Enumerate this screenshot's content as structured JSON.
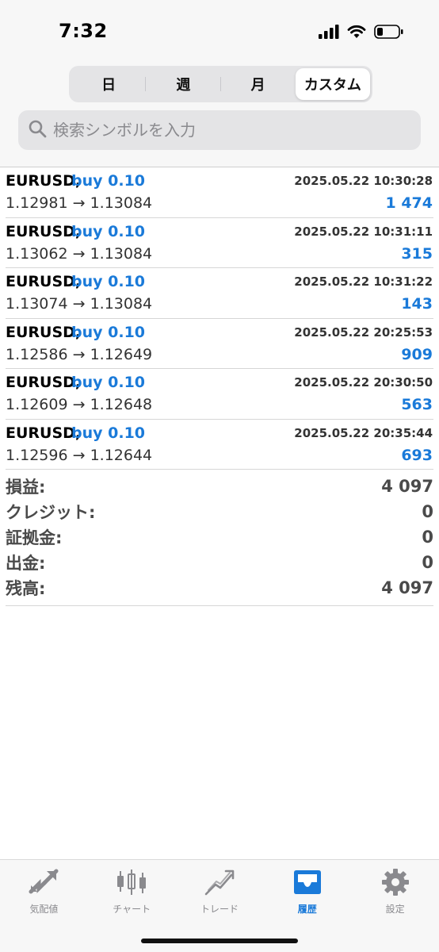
{
  "status": {
    "time": "7:32"
  },
  "segments": [
    {
      "label": "日"
    },
    {
      "label": "週"
    },
    {
      "label": "月"
    },
    {
      "label": "カスタム",
      "active": true
    }
  ],
  "search": {
    "placeholder": "検索シンボルを入力",
    "value": ""
  },
  "deals": [
    {
      "symbol": "EURUSD,",
      "type": "buy 0.10",
      "time": "2025.05.22 10:30:28",
      "prices": "1.12981 → 1.13084",
      "profit": "1 474"
    },
    {
      "symbol": "EURUSD,",
      "type": "buy 0.10",
      "time": "2025.05.22 10:31:11",
      "prices": "1.13062 → 1.13084",
      "profit": "315"
    },
    {
      "symbol": "EURUSD,",
      "type": "buy 0.10",
      "time": "2025.05.22 10:31:22",
      "prices": "1.13074 → 1.13084",
      "profit": "143"
    },
    {
      "symbol": "EURUSD,",
      "type": "buy 0.10",
      "time": "2025.05.22 20:25:53",
      "prices": "1.12586 → 1.12649",
      "profit": "909"
    },
    {
      "symbol": "EURUSD,",
      "type": "buy 0.10",
      "time": "2025.05.22 20:30:50",
      "prices": "1.12609 → 1.12648",
      "profit": "563"
    },
    {
      "symbol": "EURUSD,",
      "type": "buy 0.10",
      "time": "2025.05.22 20:35:44",
      "prices": "1.12596 → 1.12644",
      "profit": "693"
    }
  ],
  "summary": [
    {
      "label": "損益:",
      "value": "4 097"
    },
    {
      "label": "クレジット:",
      "value": "0"
    },
    {
      "label": "証拠金:",
      "value": "0"
    },
    {
      "label": "出金:",
      "value": "0"
    },
    {
      "label": "残高:",
      "value": "4 097"
    }
  ],
  "tabs": [
    {
      "label": "気配値",
      "icon": "quotes-arrows-icon"
    },
    {
      "label": "チャート",
      "icon": "candlestick-chart-icon"
    },
    {
      "label": "トレード",
      "icon": "trade-line-icon"
    },
    {
      "label": "履歴",
      "icon": "history-inbox-icon",
      "active": true
    },
    {
      "label": "設定",
      "icon": "settings-gear-icon"
    }
  ],
  "colors": {
    "accent": "#1a7ad9",
    "text": "#000000",
    "muted": "#8a8a8e"
  }
}
